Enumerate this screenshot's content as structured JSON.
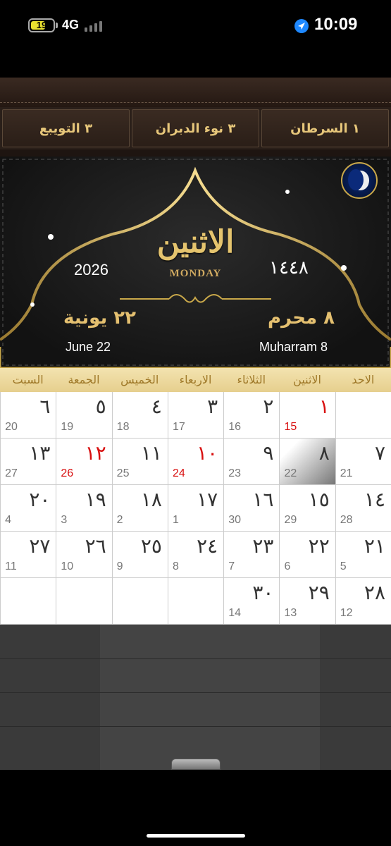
{
  "status_bar": {
    "battery_level": "19",
    "network": "4G",
    "time": "10:09",
    "icons": [
      "battery-icon",
      "signal-icon",
      "location-arrow-icon"
    ]
  },
  "stars": [
    {
      "label": "١ السرطان"
    },
    {
      "label": "٣ نوء الدبران"
    },
    {
      "label": "٣ التويبع"
    }
  ],
  "header": {
    "day_ar": "الاثنين",
    "day_en": "MONDAY",
    "hijri_year": "١٤٤٨",
    "greg_year": "2026",
    "hijri_date_ar": "٨ محرم",
    "greg_date_ar": "٢٢ يونية",
    "hijri_date_en": "Muharram 8",
    "greg_date_en": "June 22",
    "moon_icon": "moon-phase-icon",
    "gold": "#e4c070"
  },
  "weekdays": [
    "الاحد",
    "الاثنين",
    "الثلاثاء",
    "الاربعاء",
    "الخميس",
    "الجمعة",
    "السبت"
  ],
  "calendar": {
    "holiday_color": "#d81010",
    "rows": [
      [
        {
          "h": "",
          "g": ""
        },
        {
          "h": "١",
          "g": "15",
          "holiday": true
        },
        {
          "h": "٢",
          "g": "16"
        },
        {
          "h": "٣",
          "g": "17"
        },
        {
          "h": "٤",
          "g": "18"
        },
        {
          "h": "٥",
          "g": "19"
        },
        {
          "h": "٦",
          "g": "20"
        }
      ],
      [
        {
          "h": "٧",
          "g": "21"
        },
        {
          "h": "٨",
          "g": "22",
          "today": true
        },
        {
          "h": "٩",
          "g": "23"
        },
        {
          "h": "١٠",
          "g": "24",
          "holiday": true
        },
        {
          "h": "١١",
          "g": "25"
        },
        {
          "h": "١٢",
          "g": "26",
          "holiday": true
        },
        {
          "h": "١٣",
          "g": "27"
        }
      ],
      [
        {
          "h": "١٤",
          "g": "28"
        },
        {
          "h": "١٥",
          "g": "29"
        },
        {
          "h": "١٦",
          "g": "30"
        },
        {
          "h": "١٧",
          "g": "1"
        },
        {
          "h": "١٨",
          "g": "2"
        },
        {
          "h": "١٩",
          "g": "3"
        },
        {
          "h": "٢٠",
          "g": "4"
        }
      ],
      [
        {
          "h": "٢١",
          "g": "5"
        },
        {
          "h": "٢٢",
          "g": "6"
        },
        {
          "h": "٢٣",
          "g": "7"
        },
        {
          "h": "٢٤",
          "g": "8"
        },
        {
          "h": "٢٥",
          "g": "9"
        },
        {
          "h": "٢٦",
          "g": "10"
        },
        {
          "h": "٢٧",
          "g": "11"
        }
      ],
      [
        {
          "h": "٢٨",
          "g": "12"
        },
        {
          "h": "٢٩",
          "g": "13"
        },
        {
          "h": "٣٠",
          "g": "14"
        },
        {
          "h": "",
          "g": ""
        },
        {
          "h": "",
          "g": ""
        },
        {
          "h": "",
          "g": ""
        },
        {
          "h": "",
          "g": ""
        }
      ]
    ]
  }
}
